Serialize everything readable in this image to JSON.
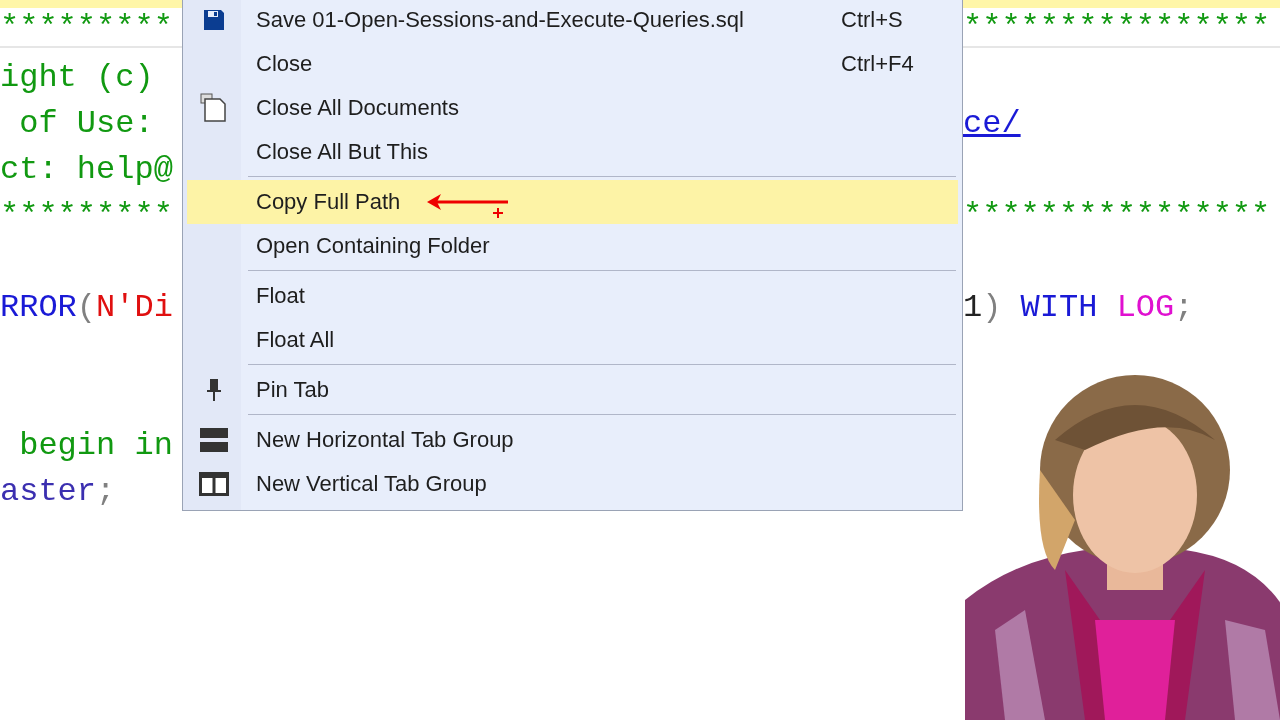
{
  "editor": {
    "lines": [
      {
        "left": [
          {
            "text": "*********",
            "kind": "comment"
          }
        ],
        "right": [
          {
            "text": "****************",
            "kind": "comment"
          }
        ]
      },
      {
        "left": [
          {
            "text": "ight (c)",
            "kind": "comment"
          }
        ]
      },
      {
        "left": [
          {
            "text": " of Use:",
            "kind": "comment"
          }
        ],
        "right": [
          {
            "text": "ce/",
            "kind": "link"
          }
        ]
      },
      {
        "left": [
          {
            "text": "ct: help@",
            "kind": "comment"
          }
        ]
      },
      {
        "left": [
          {
            "text": "*********",
            "kind": "comment"
          }
        ],
        "right": [
          {
            "text": "****************",
            "kind": "comment"
          }
        ]
      },
      {
        "left": [
          {
            "text": "RROR",
            "kind": "keyword"
          },
          {
            "text": "(",
            "kind": "punct"
          },
          {
            "text": "N'Di",
            "kind": "string"
          }
        ],
        "right": [
          {
            "text": "1",
            "kind": "plain"
          },
          {
            "text": ")",
            "kind": "punct"
          },
          {
            "text": " WITH",
            "kind": "keyword"
          },
          {
            "text": " LOG",
            "kind": "system"
          },
          {
            "text": ";",
            "kind": "punct"
          }
        ]
      },
      {
        "left": [
          {
            "text": " begin in",
            "kind": "comment"
          }
        ]
      },
      {
        "left": [
          {
            "text": "aster",
            "kind": "object"
          },
          {
            "text": ";",
            "kind": "punct"
          }
        ]
      }
    ]
  },
  "context_menu": {
    "items": [
      {
        "kind": "item",
        "label": "Save 01-Open-Sessions-and-Execute-Queries.sql",
        "shortcut": "Ctrl+S",
        "selected": false
      },
      {
        "kind": "item",
        "label": "Close",
        "shortcut": "Ctrl+F4",
        "selected": false
      },
      {
        "kind": "item",
        "label": "Close All Documents",
        "selected": false
      },
      {
        "kind": "item",
        "label": "Close All But This",
        "selected": false
      },
      {
        "kind": "separator"
      },
      {
        "kind": "item",
        "label": "Copy Full Path",
        "selected": true
      },
      {
        "kind": "item",
        "label": "Open Containing Folder",
        "selected": false
      },
      {
        "kind": "separator"
      },
      {
        "kind": "item",
        "label": "Float",
        "selected": false
      },
      {
        "kind": "item",
        "label": "Float All",
        "selected": false
      },
      {
        "kind": "separator"
      },
      {
        "kind": "item",
        "label": "Pin Tab",
        "selected": false
      },
      {
        "kind": "separator"
      },
      {
        "kind": "item",
        "label": "New Horizontal Tab Group",
        "selected": false
      },
      {
        "kind": "item",
        "label": "New Vertical Tab Group",
        "selected": false
      }
    ]
  }
}
